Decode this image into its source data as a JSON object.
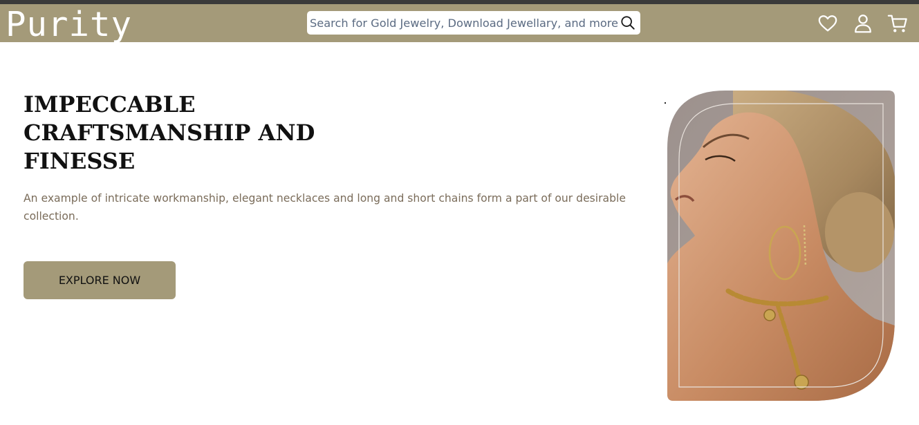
{
  "header": {
    "logo_text": "Purity",
    "search": {
      "placeholder": "Search for Gold Jewelry, Download Jewellary, and more...",
      "icon": "search-icon"
    },
    "icons": [
      "heart-icon",
      "user-icon",
      "cart-icon"
    ]
  },
  "hero": {
    "title_lines": [
      "IMPECCABLE",
      "CRAFTSMANSHIP AND",
      "FINESSE"
    ],
    "description": "An example of intricate workmanship, elegant necklaces and long and short chains form a part of our desirable collection.",
    "cta_label": "EXPLORE NOW"
  },
  "colors": {
    "brand": "#a49a79",
    "top_strip": "#3a3a3a",
    "title": "#111111",
    "description": "#7a6c5a",
    "search_text": "#5b6b82"
  }
}
